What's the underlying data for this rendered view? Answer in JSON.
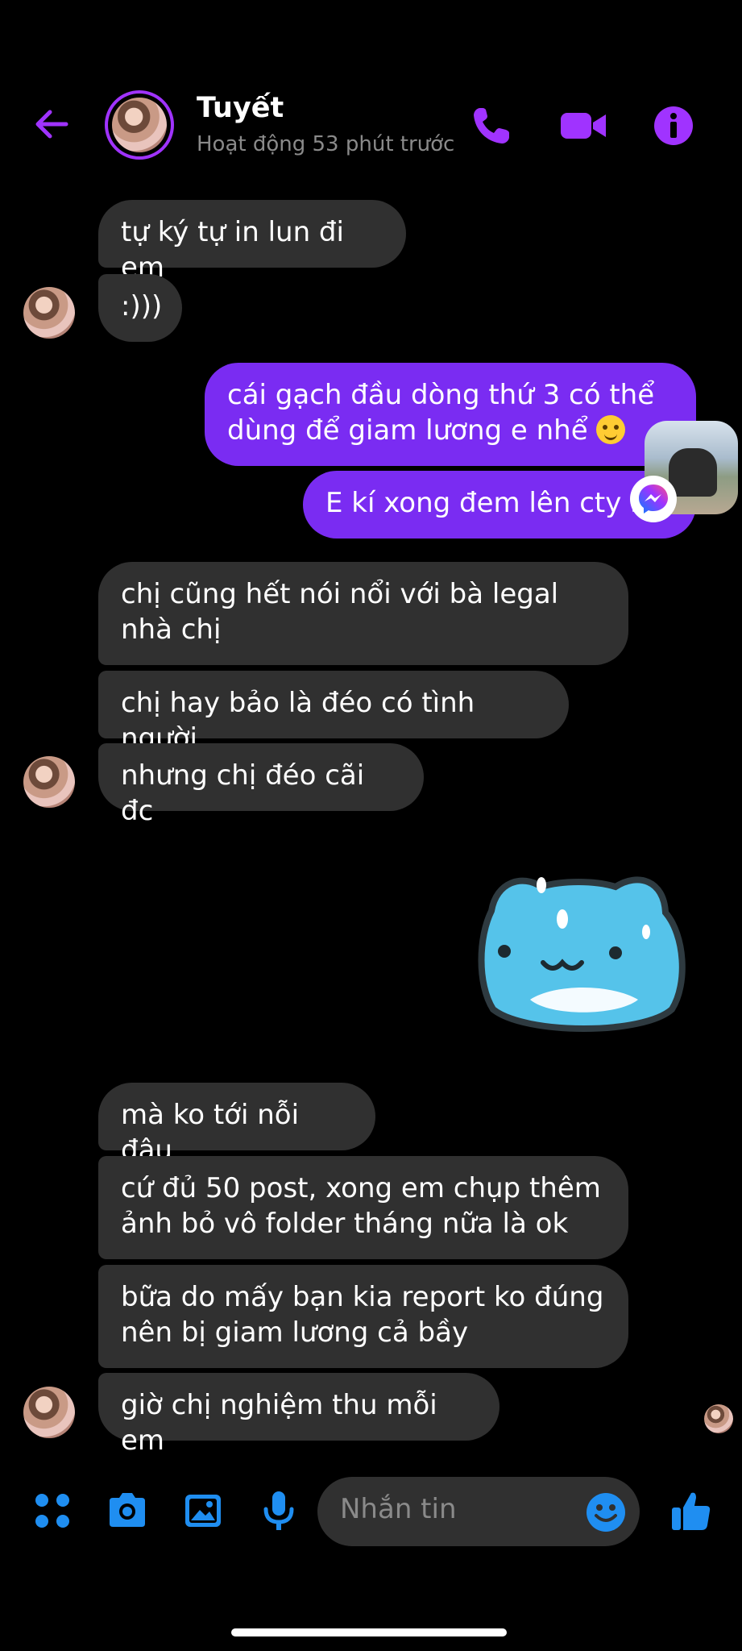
{
  "header": {
    "title": "Tuyết",
    "status": "Hoạt động 53 phút trước",
    "icons": [
      "back-arrow-icon",
      "phone-icon",
      "video-camera-icon",
      "info-icon"
    ]
  },
  "messages": [
    {
      "side": "in",
      "text": "tự ký tự in lun đi em"
    },
    {
      "side": "in",
      "text": ":)))"
    },
    {
      "side": "out",
      "text": "cái gạch đầu dòng thứ 3 có thể dùng để giam lương e nhể"
    },
    {
      "side": "out",
      "text": "E kí xong đem lên cty h"
    },
    {
      "side": "in",
      "text": "chị cũng hết nói nổi với bà legal nhà chị"
    },
    {
      "side": "in",
      "text": "chị hay bảo là đéo có tình người"
    },
    {
      "side": "in",
      "text": "nhưng chị đéo cãi đc"
    },
    {
      "side": "in",
      "text": "mà ko tới nỗi đâu"
    },
    {
      "side": "in",
      "text": "cứ đủ 50 post, xong em chụp thêm ảnh bỏ vô folder tháng nữa là ok"
    },
    {
      "side": "in",
      "text": "bữa do mấy bạn kia report ko đúng nên bị giam lương cả bầy"
    },
    {
      "side": "in",
      "text": "giờ chị nghiệm thu mỗi em"
    }
  ],
  "composer": {
    "placeholder": "Nhắn tin",
    "icons": [
      "apps-grid-icon",
      "camera-icon",
      "gallery-icon",
      "microphone-icon",
      "emoji-icon",
      "thumbs-up-icon"
    ]
  },
  "colors": {
    "accent": "#a033ff",
    "outgoing_bubble": "#7a2cf2",
    "incoming_bubble": "#303030",
    "composer_icons": "#1f8ef1"
  }
}
